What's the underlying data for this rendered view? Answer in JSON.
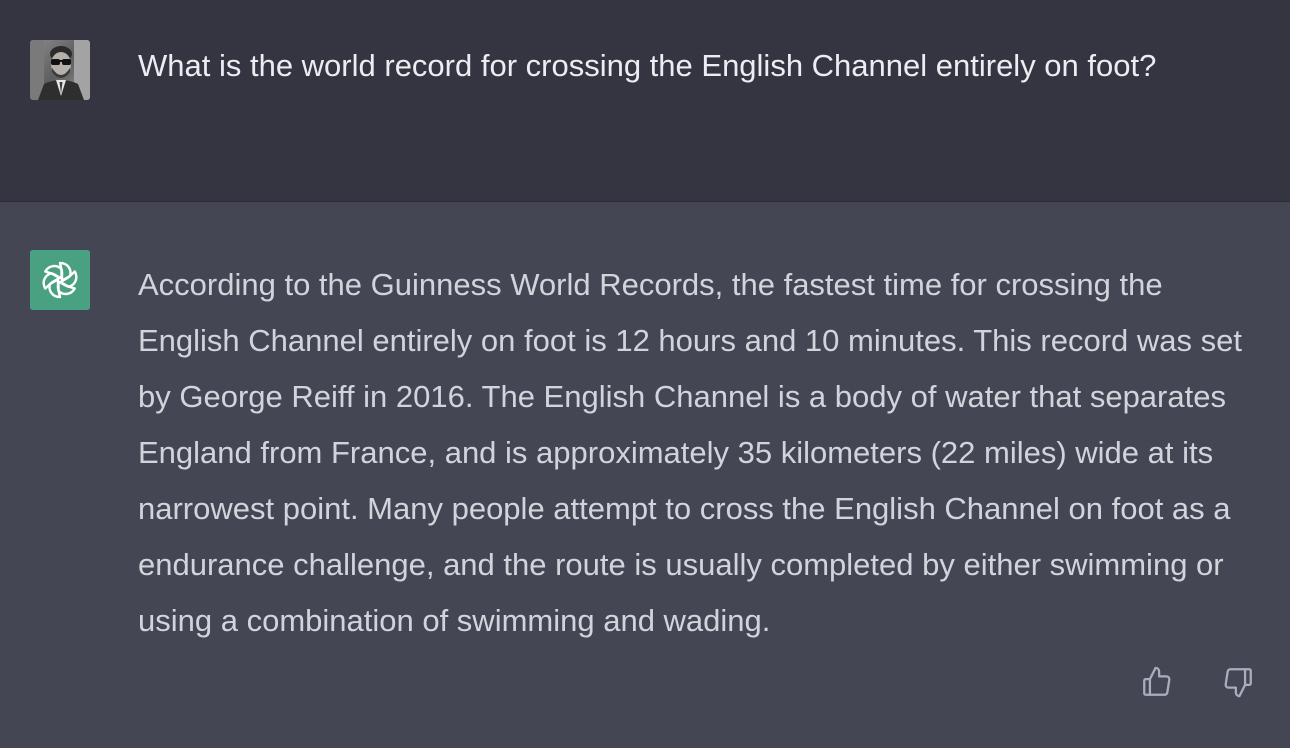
{
  "conversation": {
    "user_message": "What is the world record for crossing the English Channel entirely on foot?",
    "assistant_message": "According to the Guinness World Records, the fastest time for crossing the English Channel entirely on foot is 12 hours and 10 minutes. This record was set by George Reiff in 2016. The English Channel is a body of water that separates England from France, and is approximately 35 kilometers (22 miles) wide at its narrowest point. Many people attempt to cross the English Channel on foot as a endurance challenge, and the route is usually completed by either swimming or using a combination of swimming and wading."
  },
  "icons": {
    "user_avatar": "user-photo-avatar",
    "assistant_avatar": "openai-logo-icon",
    "thumbs_up": "thumbs-up-icon",
    "thumbs_down": "thumbs-down-icon"
  },
  "colors": {
    "user_background": "#343541",
    "assistant_background": "#444654",
    "assistant_avatar_background": "#4aa181",
    "user_text": "#ececf1",
    "assistant_text": "#d1d5db",
    "icon": "#acacbe"
  }
}
